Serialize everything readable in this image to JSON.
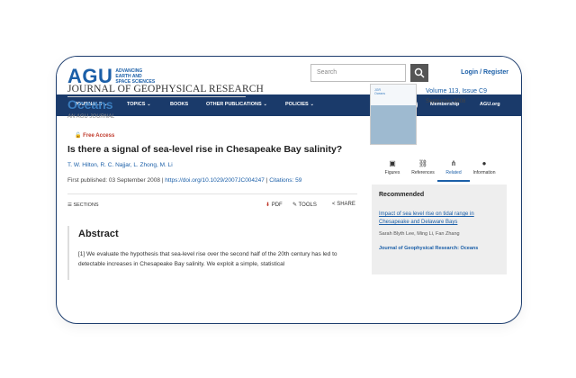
{
  "brand": {
    "logo": "AGU",
    "tagline": [
      "ADVANCING",
      "EARTH AND",
      "SPACE SCIENCES"
    ]
  },
  "header": {
    "search_placeholder": "Search",
    "login": "Login / Register"
  },
  "nav": {
    "items": [
      "JOURNALS",
      "TOPICS",
      "BOOKS",
      "OTHER PUBLICATIONS",
      "POLICIES"
    ],
    "membership": "Membership",
    "agu_org": "AGU.org"
  },
  "journal": {
    "name": "JOURNAL OF GEOPHYSICAL RESEARCH",
    "section": "Oceans",
    "tag": "AN AGU JOURNAL"
  },
  "article": {
    "access": "Free Access",
    "title": "Is there a signal of sea-level rise in Chesapeake Bay salinity?",
    "authors": "T. W. Hilton, R. C. Najjar, L. Zhong, M. Li",
    "published_label": "First published: 03 September 2008",
    "doi": "https://doi.org/10.1029/2007JC004247",
    "citations": "Citations: 59"
  },
  "toolbar": {
    "sections": "SECTIONS",
    "pdf": "PDF",
    "tools": "TOOLS",
    "share": "SHARE"
  },
  "abstract": {
    "heading": "Abstract",
    "text": "[1] We evaluate the hypothesis that sea-level rise over the second half of the 20th century has led to detectable increases in Chesapeake Bay salinity. We exploit a simple, statistical"
  },
  "issue": {
    "volume": "Volume 113, Issue C9",
    "date": "September 2008",
    "cover_text": [
      "JGR",
      "Oceans"
    ]
  },
  "tabs": [
    "Figures",
    "References",
    "Related",
    "Information"
  ],
  "recommended": {
    "heading": "Recommended",
    "link": "Impact of sea level rise on tidal range in Chesapeake and Delaware Bays",
    "authors": "Sarah Blyth Lee, Ming Li, Fan Zhang",
    "journal": "Journal of Geophysical Research: Oceans"
  },
  "colors": {
    "accent": "#1b5fa8",
    "nav_bg": "#1a3a6a"
  }
}
